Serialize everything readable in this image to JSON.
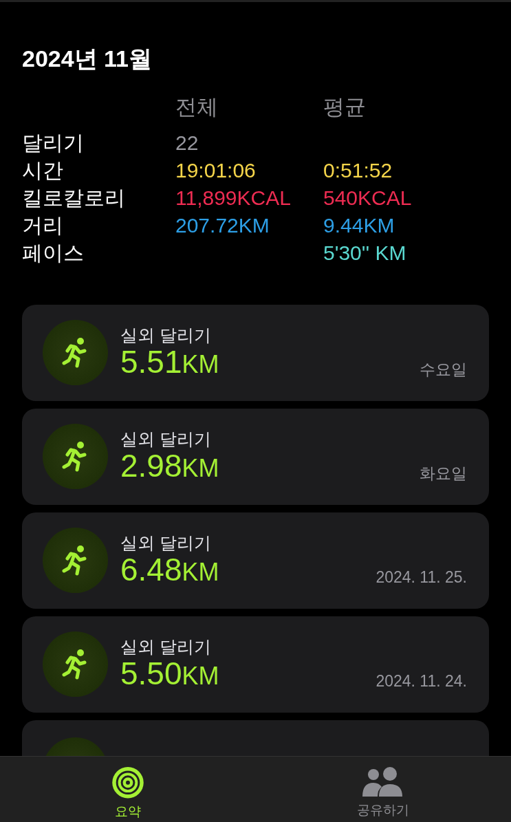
{
  "title": "2024년 11월",
  "stats": {
    "headers": [
      "전체",
      "평균"
    ],
    "rows": [
      {
        "label": "달리기",
        "total": "22",
        "average": null,
        "color": "#98989f"
      },
      {
        "label": "시간",
        "total": "19:01:06",
        "average": "0:51:52",
        "color": "#f5d54a"
      },
      {
        "label": "킬로칼로리",
        "total": "11,899KCAL",
        "average": "540KCAL",
        "color": "#ee2c52"
      },
      {
        "label": "거리",
        "total": "207.72KM",
        "average": "9.44KM",
        "color": "#2d9fe6"
      },
      {
        "label": "페이스",
        "total": null,
        "average": "5'30'' KM",
        "color": "#5ad8d0"
      }
    ]
  },
  "workouts": [
    {
      "title": "실외 달리기",
      "distance": "5.51",
      "unit": "KM",
      "date": "수요일"
    },
    {
      "title": "실외 달리기",
      "distance": "2.98",
      "unit": "KM",
      "date": "화요일"
    },
    {
      "title": "실외 달리기",
      "distance": "6.48",
      "unit": "KM",
      "date": "2024. 11. 25."
    },
    {
      "title": "실외 달리기",
      "distance": "5.50",
      "unit": "KM",
      "date": "2024. 11. 24."
    },
    {
      "kind": "partial"
    }
  ],
  "tab_bar": [
    {
      "label": "요약",
      "kind": "rings",
      "selected": true
    },
    {
      "label": "공유하기",
      "kind": "people",
      "selected": false
    }
  ]
}
